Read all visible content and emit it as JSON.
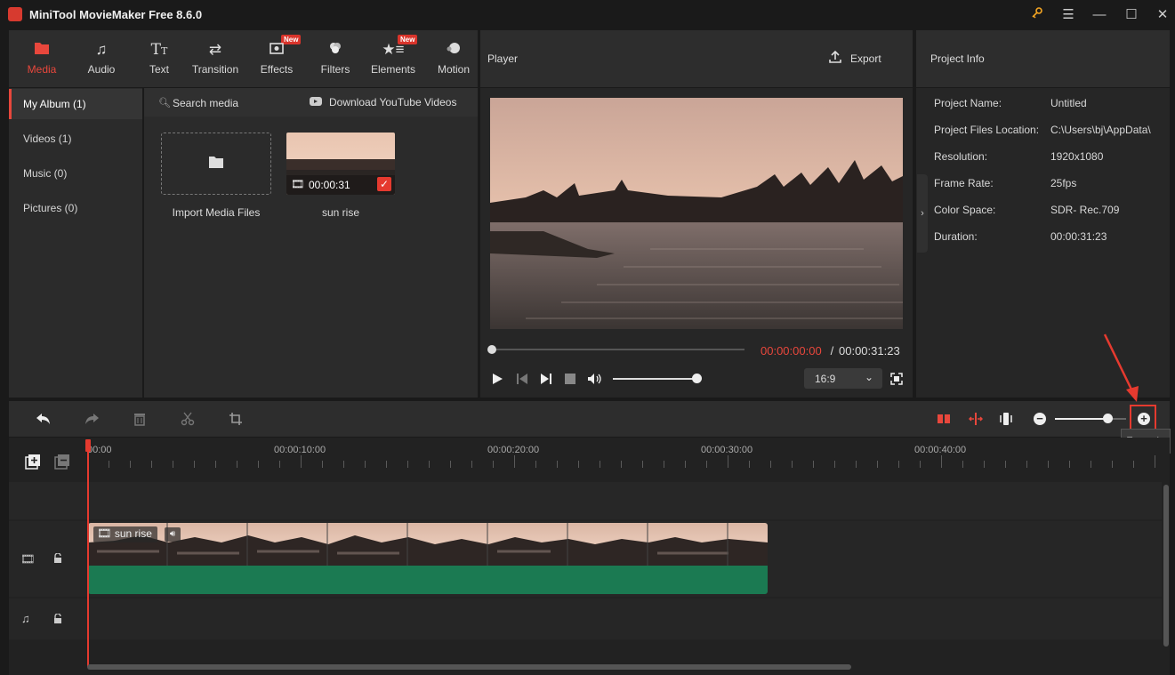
{
  "app": {
    "title": "MiniTool MovieMaker Free 8.6.0"
  },
  "tools": [
    {
      "label": "Media",
      "icon": "folder-icon",
      "active": true,
      "new": false
    },
    {
      "label": "Audio",
      "icon": "music-note-icon",
      "active": false,
      "new": false
    },
    {
      "label": "Text",
      "icon": "text-icon",
      "active": false,
      "new": false
    },
    {
      "label": "Transition",
      "icon": "transition-arrows-icon",
      "active": false,
      "new": false
    },
    {
      "label": "Effects",
      "icon": "effects-icon",
      "active": false,
      "new": true
    },
    {
      "label": "Filters",
      "icon": "filters-icon",
      "active": false,
      "new": false
    },
    {
      "label": "Elements",
      "icon": "elements-icon",
      "active": false,
      "new": true
    },
    {
      "label": "Motion",
      "icon": "motion-icon",
      "active": false,
      "new": false
    }
  ],
  "new_badge": "New",
  "sidebar": {
    "items": [
      {
        "label": "My Album (1)",
        "active": true
      },
      {
        "label": "Videos (1)",
        "active": false
      },
      {
        "label": "Music (0)",
        "active": false
      },
      {
        "label": "Pictures (0)",
        "active": false
      }
    ]
  },
  "media": {
    "search_label": "Search media",
    "download_label": "Download YouTube Videos",
    "import_label": "Import Media Files",
    "clip": {
      "name": "sun rise",
      "duration": "00:00:31"
    }
  },
  "player": {
    "title": "Player",
    "export_label": "Export",
    "current_time": "00:00:00:00",
    "separator": " / ",
    "total_time": "00:00:31:23",
    "aspect": "16:9",
    "volume_level": 0.87,
    "progress": 0.0
  },
  "project_info": {
    "title": "Project Info",
    "rows": [
      {
        "label": "Project Name:",
        "value": "Untitled"
      },
      {
        "label": "Project Files Location:",
        "value": "C:\\Users\\bj\\AppData\\"
      },
      {
        "label": "Resolution:",
        "value": "1920x1080"
      },
      {
        "label": "Frame Rate:",
        "value": "25fps"
      },
      {
        "label": "Color Space:",
        "value": "SDR- Rec.709"
      },
      {
        "label": "Duration:",
        "value": "00:00:31:23"
      }
    ]
  },
  "timeline": {
    "ruler": [
      "00:00",
      "00:00:10:00",
      "00:00:20:00",
      "00:00:30:00",
      "00:00:40:00"
    ],
    "clip_name": "sun rise",
    "zoom_tooltip": "Zoom in",
    "zoom_level": 0.75
  },
  "colors": {
    "accent": "#e8473c",
    "clip_audio": "#1b7a52",
    "highlight_box": "#e53a2f"
  }
}
